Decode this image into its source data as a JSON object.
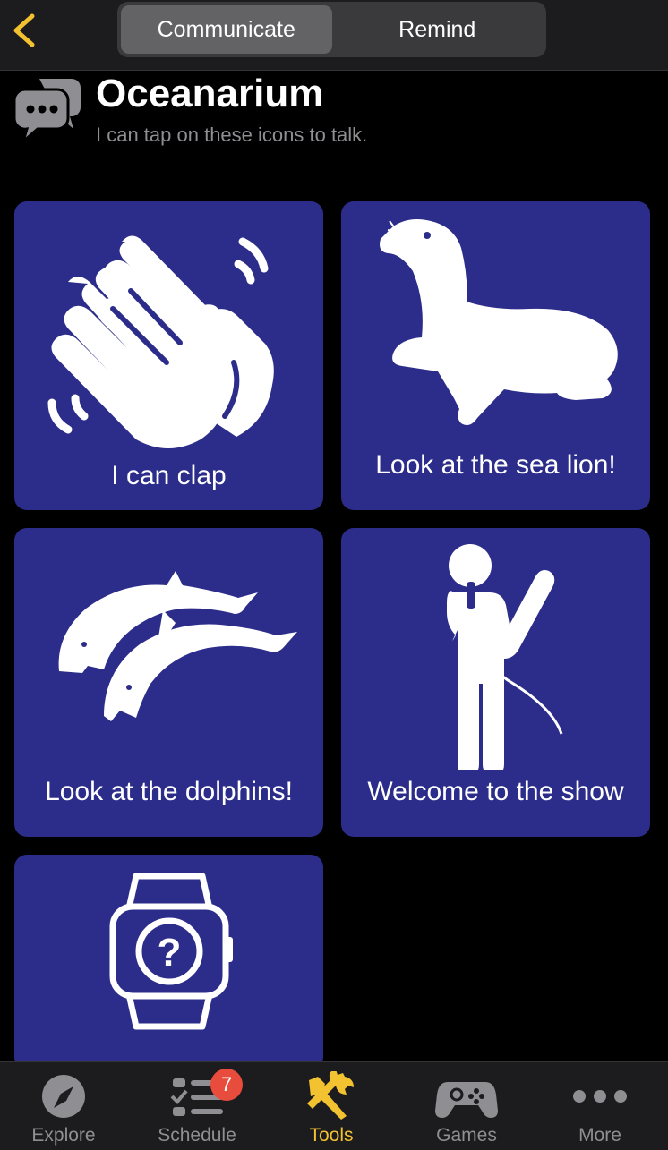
{
  "header": {
    "title": "Oceanarium",
    "subtitle": "I can tap on these icons to talk.",
    "icon": "speech-bubbles-icon"
  },
  "segmented": {
    "options": [
      {
        "label": "Communicate",
        "selected": true
      },
      {
        "label": "Remind",
        "selected": false
      }
    ]
  },
  "tiles": [
    {
      "label": "I can clap",
      "icon": "clapping-hands-icon"
    },
    {
      "label": "Look at the sea lion!",
      "icon": "sea-lion-icon"
    },
    {
      "label": "Look at the dolphins!",
      "icon": "dolphins-icon"
    },
    {
      "label": "Welcome to the show",
      "icon": "presenter-icon"
    },
    {
      "label": "",
      "icon": "watch-question-icon"
    }
  ],
  "tabbar": {
    "items": [
      {
        "label": "Explore",
        "icon": "compass-icon",
        "active": false
      },
      {
        "label": "Schedule",
        "icon": "checklist-icon",
        "active": false,
        "badge": "7"
      },
      {
        "label": "Tools",
        "icon": "tools-icon",
        "active": true
      },
      {
        "label": "Games",
        "icon": "gamepad-icon",
        "active": false
      },
      {
        "label": "More",
        "icon": "more-dots-icon",
        "active": false
      }
    ]
  },
  "colors": {
    "tile_background": "#2c2d8a",
    "accent": "#f2c230",
    "badge": "#e74c3c"
  }
}
